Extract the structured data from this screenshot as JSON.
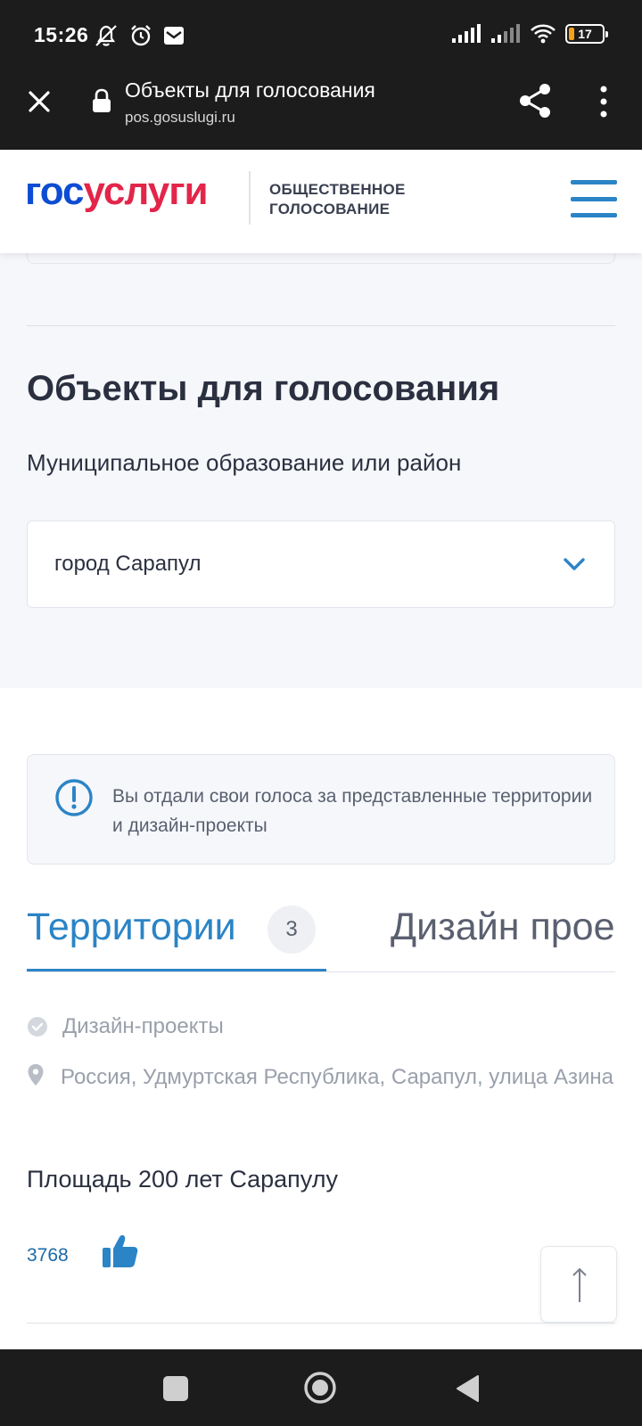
{
  "status_bar": {
    "time": "15:26",
    "battery": "17"
  },
  "browser": {
    "title": "Объекты для голосования",
    "url": "pos.gosuslugi.ru"
  },
  "header": {
    "logo_part1": "гос",
    "logo_part2": "услуги",
    "subtitle_line1": "ОБЩЕСТВЕННОЕ",
    "subtitle_line2": "ГОЛОСОВАНИЕ",
    "colors": {
      "logo_blue": "#0d4cd3",
      "logo_red": "#e3254a",
      "accent": "#2b84c6"
    }
  },
  "main": {
    "section_title": "Объекты для голосования",
    "filter_label": "Муниципальное образование или район",
    "filter_value": "город Сарапул"
  },
  "notice": {
    "icon": "info-icon",
    "text": "Вы отдали свои голоса за представленные территории и дизайн-проекты"
  },
  "tabs": [
    {
      "label": "Территории",
      "count": "3",
      "active": true
    },
    {
      "label": "Дизайн проекты",
      "active": false
    }
  ],
  "item": {
    "category": "Дизайн-проекты",
    "address": "Россия, Удмуртская Республика, Сарапул, улица Азина",
    "title": "Площадь 200 лет Сарапулу",
    "votes": "3768"
  }
}
